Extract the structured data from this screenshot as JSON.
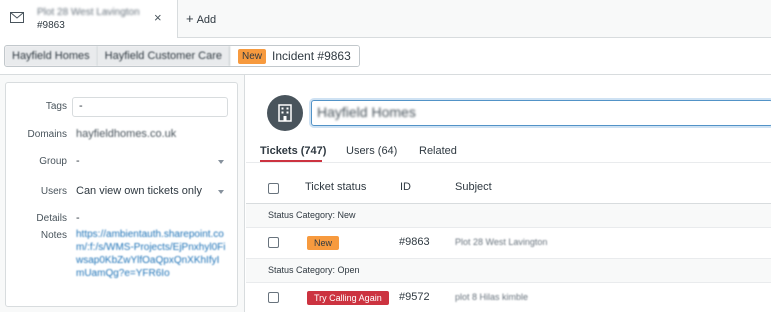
{
  "tab": {
    "title": "Plot 28 West Lavington",
    "subtitle": "#9863",
    "close_icon": "close-icon",
    "icon": "envelope-icon"
  },
  "add_tab_label": "Add",
  "breadcrumb": {
    "items": [
      "Hayfield Homes",
      "Hayfield Customer Care"
    ],
    "status_badge": "New",
    "incident": "Incident #9863"
  },
  "org_fields": {
    "tags_label": "Tags",
    "tags_value": "-",
    "domains_label": "Domains",
    "domains_value": "hayfieldhomes.co.uk",
    "group_label": "Group",
    "group_value": "-",
    "users_label": "Users",
    "users_value": "Can view own tickets only",
    "details_label": "Details",
    "details_value": "-",
    "notes_label": "Notes",
    "notes_value": "https://ambientauth.sharepoint.com/:f:/s/WMS-Projects/EjPnxhyl0Fiwsap0KbZwYlfOaQpxQnXKhIfyImUamQg?e=YFR6Io"
  },
  "org": {
    "avatar_icon": "building-icon",
    "name": "Hayfield Homes"
  },
  "subtabs": {
    "tickets": "Tickets (747)",
    "users": "Users (64)",
    "related": "Related"
  },
  "table": {
    "headers": {
      "status": "Ticket status",
      "id": "ID",
      "subject": "Subject"
    },
    "groups": [
      {
        "label": "Status Category: New",
        "rows": [
          {
            "status": "New",
            "status_color": "#f79a3e",
            "status_text_color": "#2f3941",
            "id": "#9863",
            "subject": "Plot 28 West Lavington"
          }
        ]
      },
      {
        "label": "Status Category: Open",
        "rows": [
          {
            "status": "Try Calling Again",
            "status_color": "#cc3340",
            "status_text_color": "#ffffff",
            "id": "#9572",
            "subject": "plot 8 Hilas kimble"
          }
        ]
      }
    ]
  },
  "colors": {
    "accent": "#cc3340",
    "new_badge": "#f79a3e",
    "link": "#1f73b7"
  }
}
